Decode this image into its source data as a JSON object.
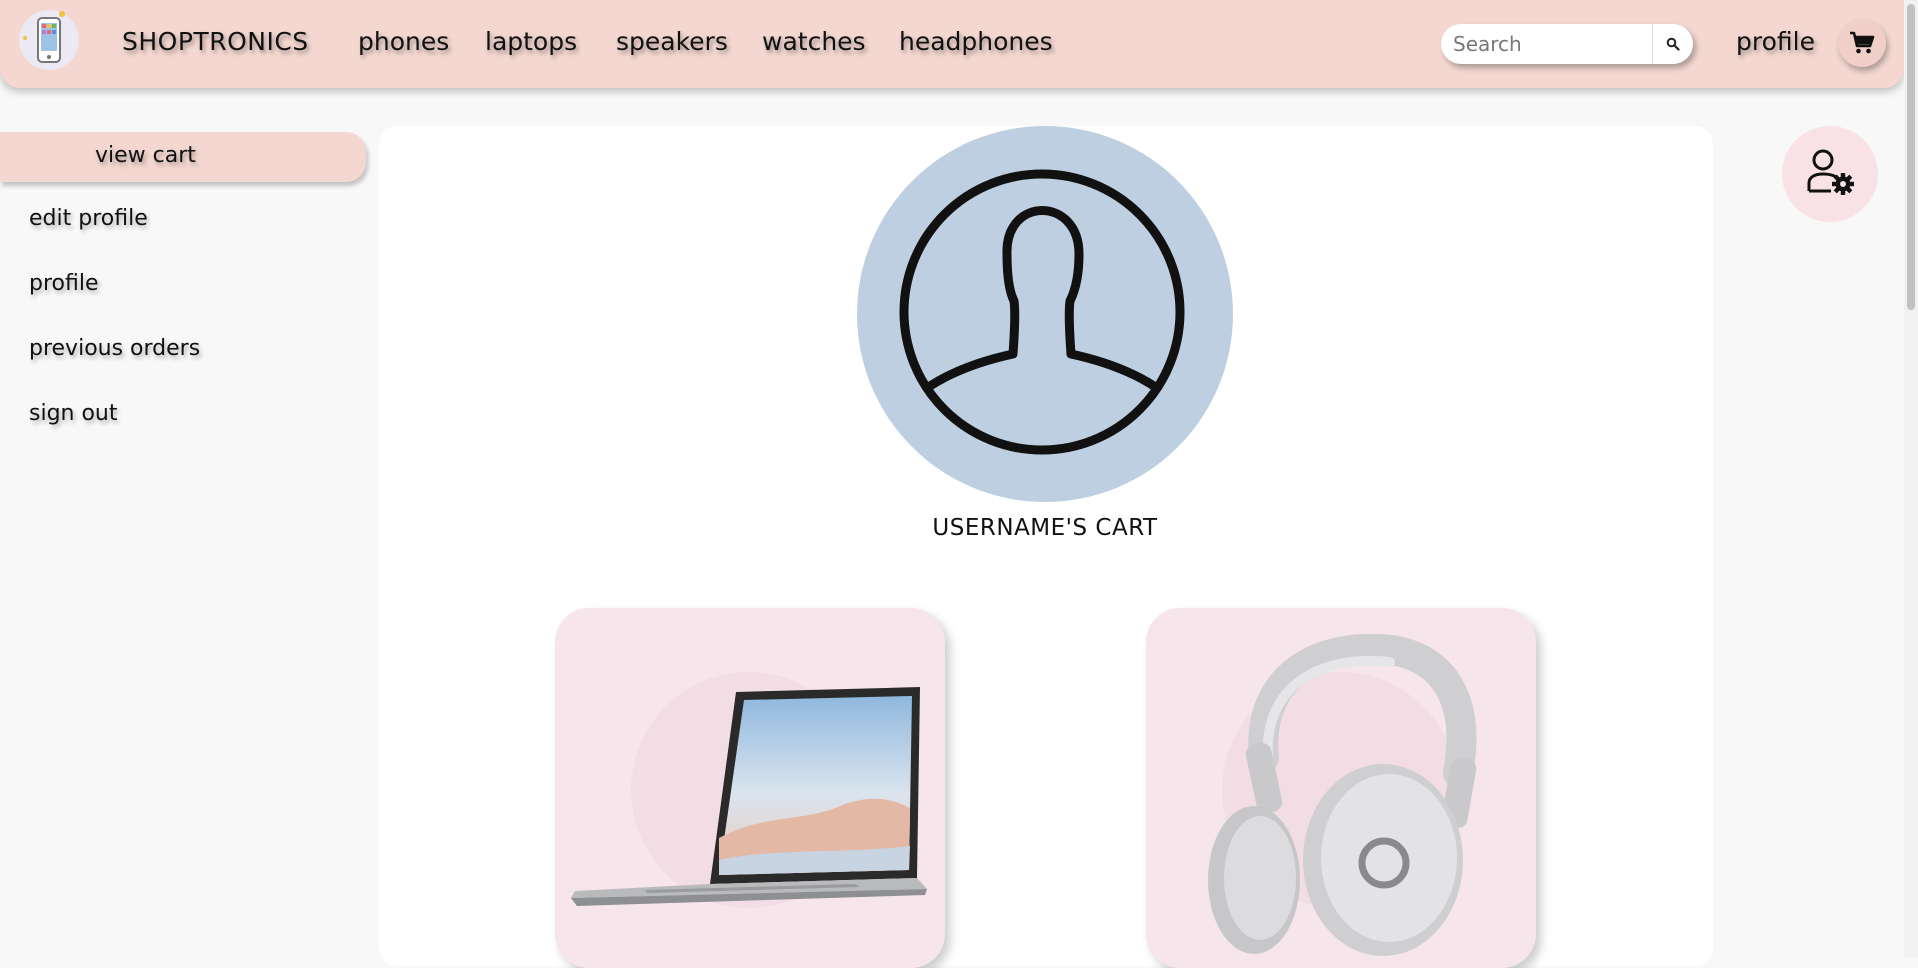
{
  "header": {
    "brand": "SHOPTRONICS",
    "nav": [
      "phones",
      "laptops",
      "speakers",
      "watches",
      "headphones"
    ],
    "search_placeholder": "Search",
    "profile_label": "profile"
  },
  "sidebar": {
    "items": [
      "view cart",
      "edit profile",
      "profile",
      "previous orders",
      "sign out"
    ],
    "active_index": 0
  },
  "main": {
    "cart_title": "USERNAME'S CART",
    "products": [
      {
        "icon": "laptop-image"
      },
      {
        "icon": "headphones-image"
      }
    ]
  },
  "colors": {
    "navbar": "#f3d7d0",
    "avatar_bg": "#bdcfe0",
    "card_bg": "#f6e5eb",
    "page_bg": "#f8f8f8"
  },
  "icons": {
    "logo": "phone-logo-icon",
    "search": "search-icon",
    "cart": "cart-icon",
    "avatar": "user-avatar-icon",
    "settings": "user-settings-icon"
  }
}
